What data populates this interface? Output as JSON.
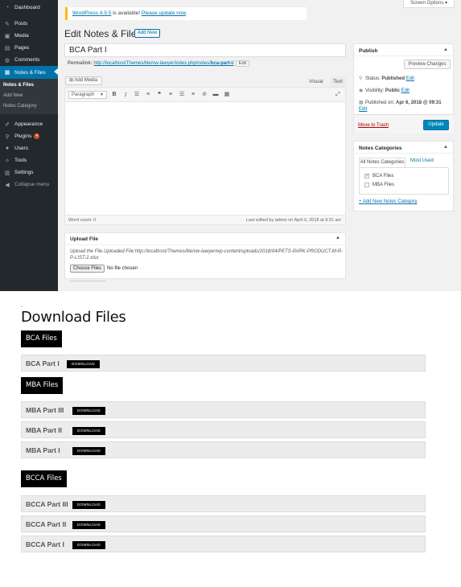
{
  "admin": {
    "sidebar": {
      "items": [
        {
          "label": "Dashboard",
          "icon": "dashboard-icon"
        },
        {
          "label": "Posts",
          "icon": "pin-icon"
        },
        {
          "label": "Media",
          "icon": "media-icon"
        },
        {
          "label": "Pages",
          "icon": "page-icon"
        },
        {
          "label": "Comments",
          "icon": "comment-icon"
        },
        {
          "label": "Notes & Files",
          "icon": "document-icon"
        },
        {
          "label": "Appearance",
          "icon": "brush-icon"
        },
        {
          "label": "Plugins",
          "icon": "plug-icon",
          "badge": "4"
        },
        {
          "label": "Users",
          "icon": "user-icon"
        },
        {
          "label": "Tools",
          "icon": "wrench-icon"
        },
        {
          "label": "Settings",
          "icon": "settings-icon"
        },
        {
          "label": "Collapse menu",
          "icon": "collapse-icon"
        }
      ],
      "submenu": [
        "Notes & Files",
        "Add New",
        "Notes Category"
      ]
    },
    "notice": {
      "link1": "WordPress 4.9.5",
      "text": " is available! ",
      "link2": "Please update now",
      "end": "."
    },
    "screen_options": "Screen Options",
    "page_title": "Edit Notes & Files",
    "add_new": "Add New",
    "post_title": "BCA Part I",
    "permalink": {
      "label": "Permalink:",
      "url_pre": "http://localhost/Themes/lite/vw-lawyer/index.php/notes/",
      "url_bold": "bca-part-i",
      "url_end": "/",
      "edit": "Edit"
    },
    "editor": {
      "add_media": "Add Media",
      "tab_visual": "Visual",
      "tab_text": "Text",
      "format": "Paragraph",
      "word_count": "Word count: 0",
      "last_edited": "Last edited by admin on April 6, 2018 at 9:31 am"
    },
    "upload": {
      "title": "Upload File",
      "description": "Upload the File.Uploaded File:http://localhost/Themes/lite/vw-lawyer/wp-content/uploads/2018/04/PETS-PARK-PRODUCT-M-R-P-LIST-2.xlsx",
      "choose": "Choose Files",
      "no_file": "No file chosen"
    },
    "publish": {
      "title": "Publish",
      "preview": "Preview Changes",
      "status_label": "Status:",
      "status_value": "Published",
      "visibility_label": "Visibility:",
      "visibility_value": "Public",
      "published_label": "Published on:",
      "published_value": "Apr 6, 2018 @ 09:31",
      "edit": "Edit",
      "trash": "Move to Trash",
      "update": "Update"
    },
    "categories": {
      "title": "Notes Categories",
      "tab_all": "All Notes Categories",
      "tab_used": "Most Used",
      "items": [
        {
          "label": "BCA Files",
          "checked": true
        },
        {
          "label": "MBA Files",
          "checked": false
        }
      ],
      "add_link": "+ Add New Notes Category"
    }
  },
  "front": {
    "title": "Download Files",
    "download_label": "DOWNLOAD",
    "sections": [
      {
        "name": "BCA Files",
        "files": [
          "BCA Part I"
        ]
      },
      {
        "name": "MBA Files",
        "files": [
          "MBA Part III",
          "MBA Part II",
          "MBA Part I"
        ]
      },
      {
        "name": "BCCA Files",
        "files": [
          "BCCA Part III",
          "BCCA Part II",
          "BCCA Part I"
        ]
      }
    ]
  },
  "colors": {
    "sidebar": "#23282d",
    "active": "#0073aa",
    "update_button": "#0085ba",
    "download_button": "#000000"
  }
}
